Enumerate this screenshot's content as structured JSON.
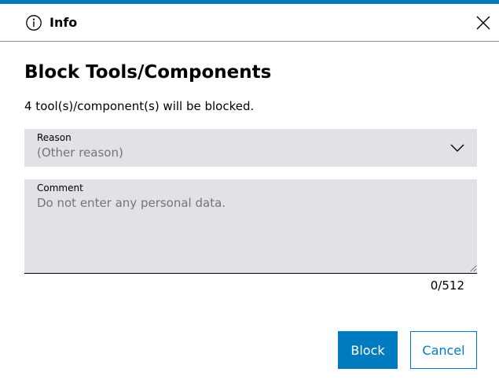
{
  "header": {
    "title": "Info",
    "icon": "info-icon",
    "close_icon": "close-icon"
  },
  "dialog": {
    "title": "Block Tools/Components",
    "message": "4 tool(s)/component(s) will be blocked."
  },
  "reason": {
    "label": "Reason",
    "value": "(Other reason)",
    "icon": "chevron-down-icon"
  },
  "comment": {
    "label": "Comment",
    "placeholder": "Do not enter any personal data.",
    "value": "",
    "counter": "0/512"
  },
  "buttons": {
    "block_label": "Block",
    "cancel_label": "Cancel"
  },
  "colors": {
    "accent": "#007bc0",
    "field_background": "#e0e2e5",
    "placeholder_text": "#71767c"
  }
}
